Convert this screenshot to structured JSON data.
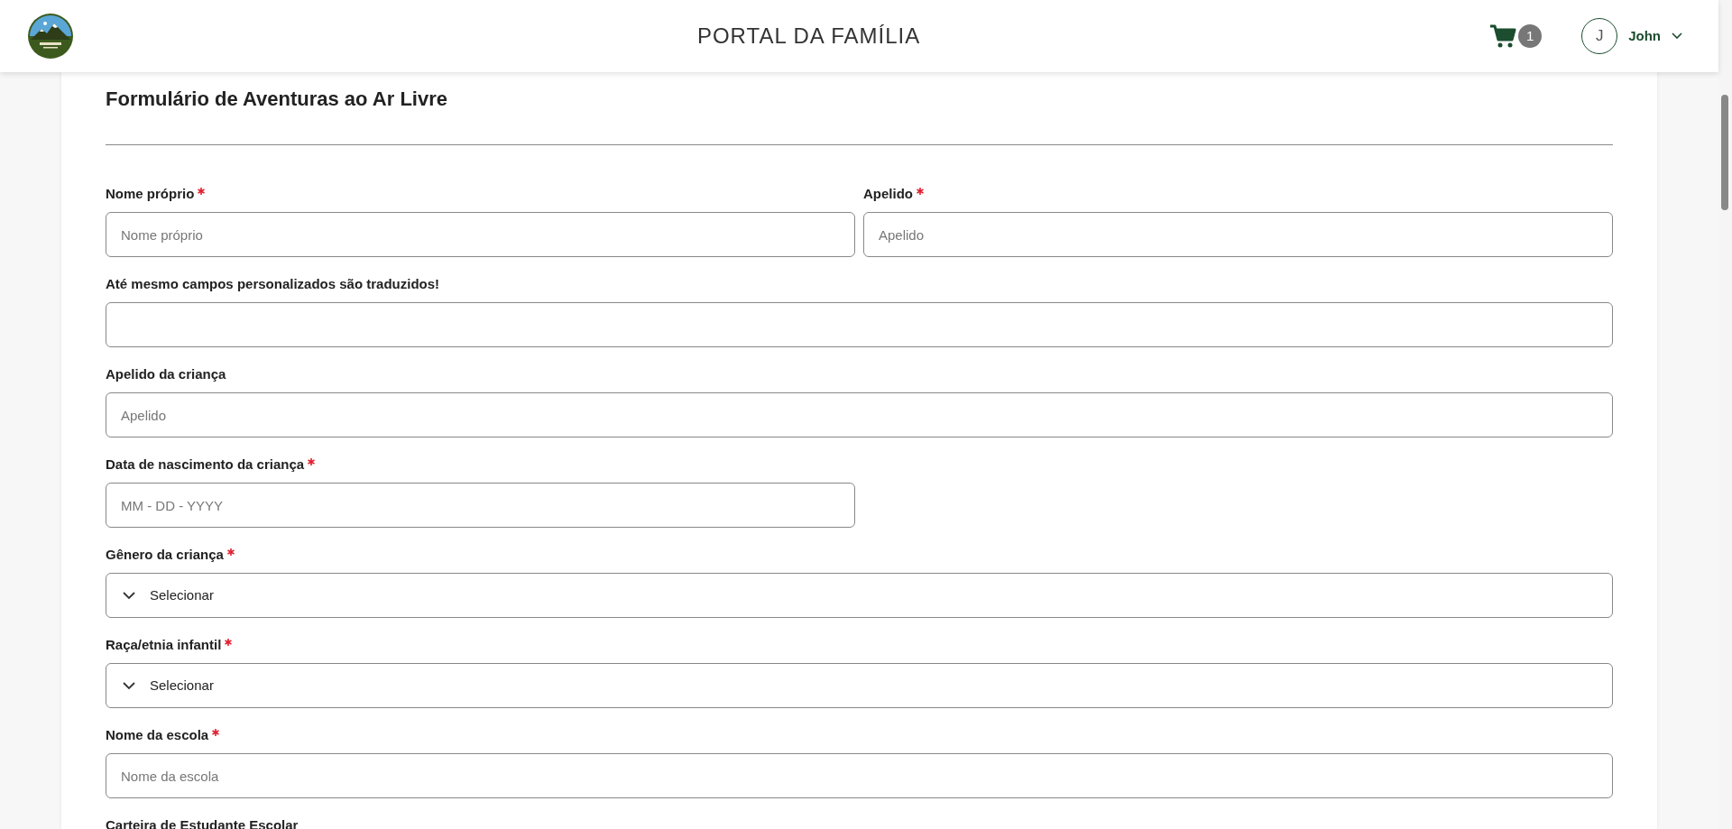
{
  "header": {
    "title": "PORTAL DA FAMÍLIA",
    "cart_count": "1",
    "user": {
      "initial": "J",
      "name": "John"
    }
  },
  "form": {
    "title": "Formulário de Aventuras ao Ar Livre",
    "rows": [
      {
        "fields": [
          {
            "kind": "text",
            "label": "Nome próprio",
            "required": true,
            "placeholder": "Nome próprio"
          },
          {
            "kind": "text",
            "label": "Apelido",
            "required": true,
            "placeholder": "Apelido"
          }
        ]
      },
      {
        "fields": [
          {
            "kind": "text",
            "label": "Até mesmo campos personalizados são traduzidos!",
            "required": false
          }
        ]
      },
      {
        "fields": [
          {
            "kind": "text",
            "label": "Apelido da criança",
            "required": false,
            "placeholder": "Apelido"
          }
        ]
      },
      {
        "fields": [
          {
            "kind": "date",
            "label": "Data de nascimento da criança",
            "required": true,
            "placeholder": "MM - DD - YYYY"
          }
        ]
      },
      {
        "fields": [
          {
            "kind": "select",
            "label": "Gênero da criança",
            "required": true,
            "value": "Selecionar"
          }
        ]
      },
      {
        "fields": [
          {
            "kind": "select",
            "label": "Raça/etnia infantil",
            "required": true,
            "value": "Selecionar"
          }
        ]
      },
      {
        "fields": [
          {
            "kind": "text",
            "label": "Nome da escola",
            "required": true,
            "placeholder": "Nome da escola"
          }
        ]
      },
      {
        "fields": [
          {
            "kind": "label_only",
            "label": "Carteira de Estudante Escolar",
            "required": false
          }
        ]
      }
    ]
  }
}
